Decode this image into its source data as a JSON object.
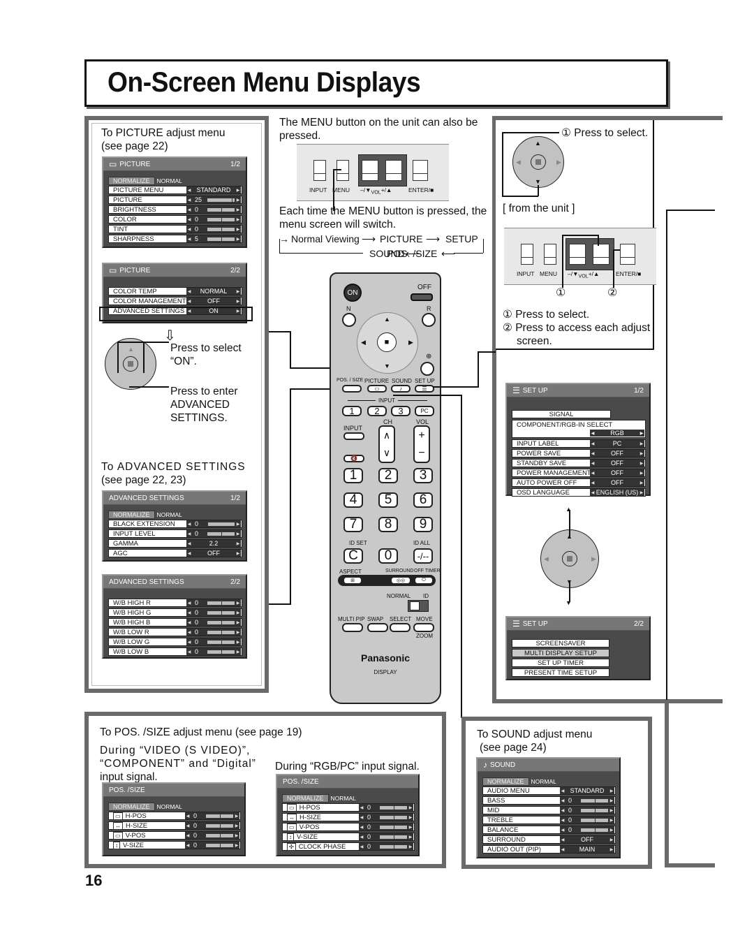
{
  "page": {
    "title": "On-Screen Menu Displays",
    "page_number": "16"
  },
  "picture_section": {
    "intro_line1": "To PICTURE adjust menu",
    "intro_line2": "(see page 22)",
    "menu1": {
      "title": "PICTURE",
      "page": "1/2",
      "icon": "picture-icon",
      "normalize": "NORMALIZE",
      "normal": "NORMAL",
      "rows": [
        {
          "label": "PICTURE MENU",
          "value": "STANDARD",
          "type": "select"
        },
        {
          "label": "PICTURE",
          "value": "25",
          "type": "slider",
          "level": 0.9
        },
        {
          "label": "BRIGHTNESS",
          "value": "0",
          "type": "slider",
          "level": 0.5
        },
        {
          "label": "COLOR",
          "value": "0",
          "type": "slider",
          "level": 0.5
        },
        {
          "label": "TINT",
          "value": "0",
          "type": "slider",
          "level": 0.5
        },
        {
          "label": "SHARPNESS",
          "value": "5",
          "type": "slider",
          "level": 0.5
        }
      ]
    },
    "menu2": {
      "title": "PICTURE",
      "page": "2/2",
      "icon": "picture-icon",
      "rows": [
        {
          "label": "COLOR TEMP",
          "value": "NORMAL",
          "type": "select"
        },
        {
          "label": "COLOR MANAGEMENT",
          "value": "OFF",
          "type": "select"
        },
        {
          "label": "ADVANCED SETTINGS",
          "value": "ON",
          "type": "select",
          "highlighted": true
        }
      ]
    },
    "press_select_line1": "Press to select",
    "press_select_line2": "“ON”.",
    "press_enter_line1": "Press to enter",
    "press_enter_line2": "ADVANCED",
    "press_enter_line3": "SETTINGS.",
    "adv_intro_line1": "To ADVANCED SETTINGS",
    "adv_intro_line2": "(see page 22, 23)",
    "adv1": {
      "title": "ADVANCED SETTINGS",
      "page": "1/2",
      "normalize": "NORMALIZE",
      "normal": "NORMAL",
      "rows": [
        {
          "label": "BLACK EXTENSION",
          "value": "0",
          "type": "slider",
          "level": 0.0
        },
        {
          "label": "INPUT LEVEL",
          "value": "0",
          "type": "slider",
          "level": 0.5
        },
        {
          "label": "GAMMA",
          "value": "2.2",
          "type": "select"
        },
        {
          "label": "AGC",
          "value": "OFF",
          "type": "select"
        }
      ]
    },
    "adv2": {
      "title": "ADVANCED SETTINGS",
      "page": "2/2",
      "rows": [
        {
          "label": "W/B HIGH R",
          "value": "0",
          "type": "slider",
          "level": 0.5
        },
        {
          "label": "W/B HIGH G",
          "value": "0",
          "type": "slider",
          "level": 0.5
        },
        {
          "label": "W/B HIGH B",
          "value": "0",
          "type": "slider",
          "level": 0.5
        },
        {
          "label": "W/B LOW R",
          "value": "0",
          "type": "slider",
          "level": 0.5
        },
        {
          "label": "W/B LOW G",
          "value": "0",
          "type": "slider",
          "level": 0.5
        },
        {
          "label": "W/B LOW B",
          "value": "0",
          "type": "slider",
          "level": 0.5
        }
      ]
    }
  },
  "center": {
    "menu_note_line1": "The MENU button on the unit can also be",
    "menu_note_line2": "pressed.",
    "unit_labels": {
      "input": "INPUT",
      "menu": "MENU",
      "vol_minus": "–/▼",
      "vol": "VOL",
      "vol_plus": "+/▲",
      "enter": "ENTER/■"
    },
    "each_time_line1": "Each time the MENU button is pressed, the",
    "each_time_line2": "menu screen will switch.",
    "cycle": [
      "Normal Viewing",
      "PICTURE",
      "SETUP",
      "POS. /SIZE",
      "SOUND"
    ]
  },
  "remote": {
    "on": "ON",
    "off": "OFF",
    "n": "N",
    "r": "R",
    "pos_size": "POS. / SIZE",
    "picture": "PICTURE",
    "sound": "SOUND",
    "setup": "SET UP",
    "input_group": "INPUT",
    "in1": "1",
    "in2": "2",
    "in3": "3",
    "pc": "PC",
    "ch": "CH",
    "vol": "VOL",
    "input": "INPUT",
    "keys": [
      "1",
      "2",
      "3",
      "4",
      "5",
      "6",
      "7",
      "8",
      "9",
      "C",
      "0",
      "-/--"
    ],
    "id_set": "ID SET",
    "id_all": "ID ALL",
    "aspect": "ASPECT",
    "surround": "SURROUND",
    "off_timer": "OFF TIMER",
    "normal": "NORMAL",
    "id": "ID",
    "multi_pip": "MULTI PIP",
    "swap": "SWAP",
    "select": "SELECT",
    "move": "MOVE",
    "zoom": "ZOOM",
    "brand": "Panasonic",
    "display": "DISPLAY"
  },
  "setup_section": {
    "press_select_top": "① Press to select.",
    "from_unit": "[ from the unit ]",
    "callout1": "①",
    "callout2": "②",
    "note1": "① Press to select.",
    "note2_line1": "② Press to access each adjust",
    "note2_line2": "screen.",
    "menu1": {
      "title": "SET UP",
      "page": "1/2",
      "icon": "setup-list-icon",
      "signal": "SIGNAL",
      "component_select": "COMPONENT/RGB-IN SELECT",
      "component_value": "RGB",
      "rows": [
        {
          "label": "INPUT LABEL",
          "value": "PC"
        },
        {
          "label": "POWER SAVE",
          "value": "OFF"
        },
        {
          "label": "STANDBY SAVE",
          "value": "OFF"
        },
        {
          "label": "POWER MANAGEMENT",
          "value": "OFF"
        },
        {
          "label": "AUTO POWER OFF",
          "value": "OFF"
        },
        {
          "label": "OSD LANGUAGE",
          "value": "ENGLISH (US)"
        }
      ]
    },
    "menu2": {
      "title": "SET UP",
      "page": "2/2",
      "icon": "setup-list-icon",
      "items": [
        {
          "label": "SCREENSAVER",
          "highlighted": false
        },
        {
          "label": "MULTI DISPLAY SETUP",
          "highlighted": true
        },
        {
          "label": "SET UP TIMER",
          "highlighted": false
        },
        {
          "label": "PRESENT TIME SETUP",
          "highlighted": false
        }
      ]
    }
  },
  "pos_section": {
    "intro": "To POS. /SIZE adjust menu (see page 19)",
    "video_line1": "During “VIDEO (S VIDEO)”,",
    "video_line2": "“COMPONENT” and “Digital”",
    "video_line3": "input signal.",
    "rgb_line": "During “RGB/PC” input signal.",
    "menu_video": {
      "title": "POS. /SIZE",
      "normalize": "NORMALIZE",
      "normal": "NORMAL",
      "rows": [
        {
          "label": "H-POS",
          "value": "0",
          "icon": "h-pos-icon",
          "level": 0.5
        },
        {
          "label": "H-SIZE",
          "value": "0",
          "icon": "h-size-icon",
          "level": 0.5
        },
        {
          "label": "V-POS",
          "value": "0",
          "icon": "v-pos-icon",
          "level": 0.5
        },
        {
          "label": "V-SIZE",
          "value": "0",
          "icon": "v-size-icon",
          "level": 0.5
        }
      ]
    },
    "menu_rgb": {
      "title": "POS. /SIZE",
      "normalize": "NORMALIZE",
      "normal": "NORMAL",
      "rows": [
        {
          "label": "H-POS",
          "value": "0",
          "icon": "h-pos-icon",
          "level": 0.5
        },
        {
          "label": "H-SIZE",
          "value": "0",
          "icon": "h-size-icon",
          "level": 0.5
        },
        {
          "label": "V-POS",
          "value": "0",
          "icon": "v-pos-icon",
          "level": 0.5
        },
        {
          "label": "V-SIZE",
          "value": "0",
          "icon": "v-size-icon",
          "level": 0.5
        },
        {
          "label": "CLOCK PHASE",
          "value": "0",
          "icon": "clock-phase-icon",
          "level": 0.5
        }
      ]
    }
  },
  "sound_section": {
    "intro_line1": "To SOUND adjust menu",
    "intro_line2": "(see page 24)",
    "menu": {
      "title": "SOUND",
      "icon": "note-icon",
      "normalize": "NORMALIZE",
      "normal": "NORMAL",
      "rows": [
        {
          "label": "AUDIO MENU",
          "value": "STANDARD",
          "type": "select"
        },
        {
          "label": "BASS",
          "value": "0",
          "type": "slider",
          "level": 0.5
        },
        {
          "label": "MID",
          "value": "0",
          "type": "slider",
          "level": 0.5
        },
        {
          "label": "TREBLE",
          "value": "0",
          "type": "slider",
          "level": 0.5
        },
        {
          "label": "BALANCE",
          "value": "0",
          "type": "slider",
          "level": 0.5
        },
        {
          "label": "SURROUND",
          "value": "OFF",
          "type": "select"
        },
        {
          "label": "AUDIO OUT (PIP)",
          "value": "MAIN",
          "type": "select"
        }
      ]
    }
  }
}
